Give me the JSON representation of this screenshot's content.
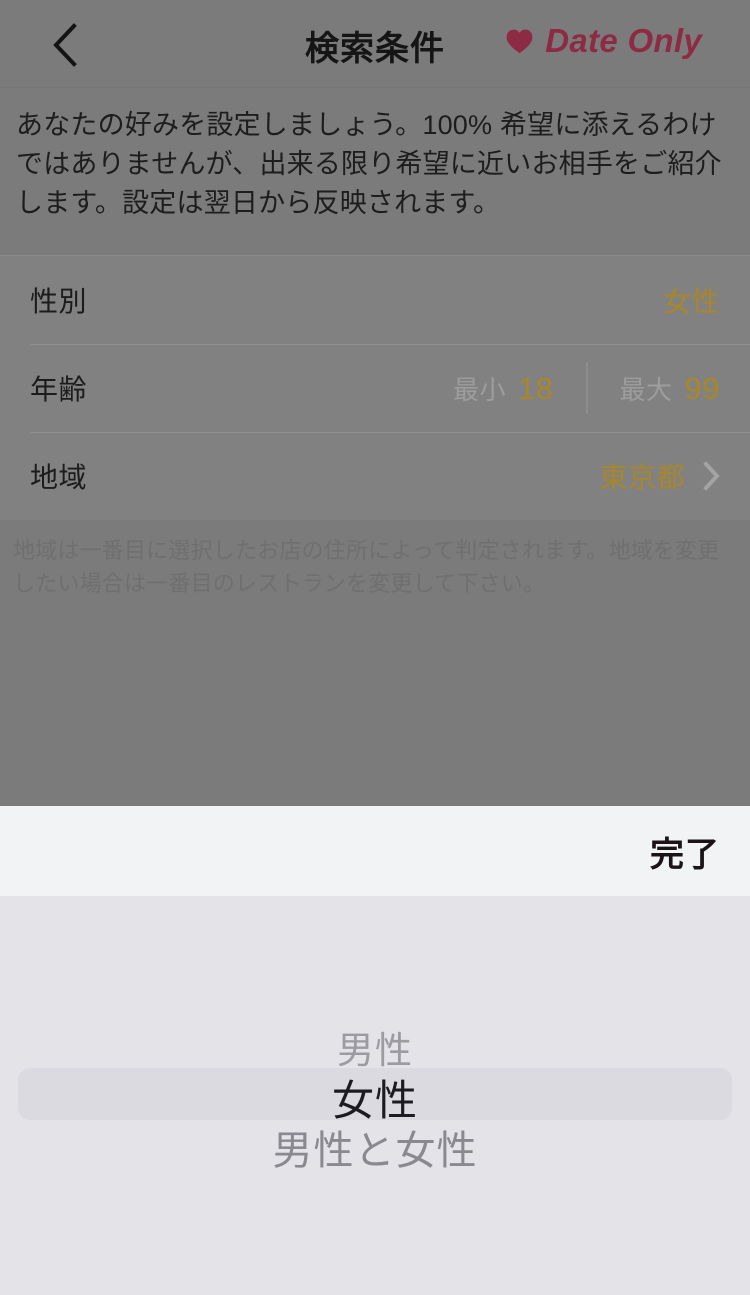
{
  "header": {
    "back_icon": "chevron-left-icon",
    "title": "検索条件",
    "brand_icon": "heart-icon",
    "brand_text": "Date Only",
    "brand_color": "#8e2b44"
  },
  "description": "あなたの好みを設定しましょう。100% 希望に添えるわけではありませんが、出来る限り希望に近いお相手をご紹介します。設定は翌日から反映されます。",
  "settings": {
    "accent_color": "#a8862a",
    "rows": [
      {
        "label": "性別",
        "value": "女性",
        "type": "value"
      },
      {
        "label": "年齢",
        "type": "range",
        "min_caption": "最小",
        "min_value": "18",
        "max_caption": "最大",
        "max_value": "99"
      },
      {
        "label": "地域",
        "value": "東京都",
        "type": "disclosure",
        "chevron_icon": "chevron-right-icon"
      }
    ]
  },
  "note": "地域は一番目に選択したお店の住所によって判定されます。地域を変更したい場合は一番目のレストランを変更して下さい。",
  "picker": {
    "done_label": "完了",
    "options": [
      "男性",
      "女性",
      "男性と女性"
    ],
    "selected": "女性",
    "above": "男性",
    "below": "男性と女性"
  }
}
